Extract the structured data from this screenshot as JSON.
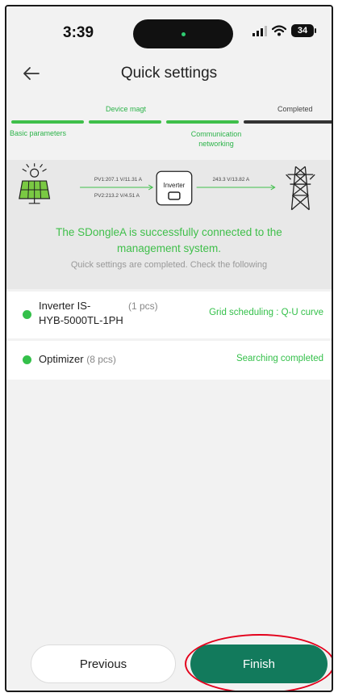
{
  "status_bar": {
    "time": "3:39",
    "battery": "34"
  },
  "header": {
    "title": "Quick settings"
  },
  "steps": {
    "top_labels": [
      "Device magt",
      "Completed"
    ],
    "bottom_labels": [
      "Basic parameters",
      "Communication networking"
    ]
  },
  "connection": {
    "pv1": "PV1:207.1 V/11.31 A",
    "pv2": "PV2:213.2 V/4.51 A",
    "inverter_label": "Inverter",
    "grid": "243.3 V/13.82 A",
    "message": "The SDongleA is successfully connected to the management system.",
    "sub_message": "Quick settings are completed. Check the following"
  },
  "devices": [
    {
      "name_line1": "Inverter IS-",
      "name_line2": "HYB-5000TL-1PH",
      "count": "(1 pcs)",
      "status": "Grid scheduling : Q-U curve"
    },
    {
      "name_line1": "Optimizer",
      "count": "(8 pcs)",
      "status": "Searching completed"
    }
  ],
  "buttons": {
    "previous": "Previous",
    "finish": "Finish"
  },
  "colors": {
    "accent_green": "#2db34a",
    "finish_button": "#127a5c",
    "highlight_circle": "#e3001b"
  }
}
